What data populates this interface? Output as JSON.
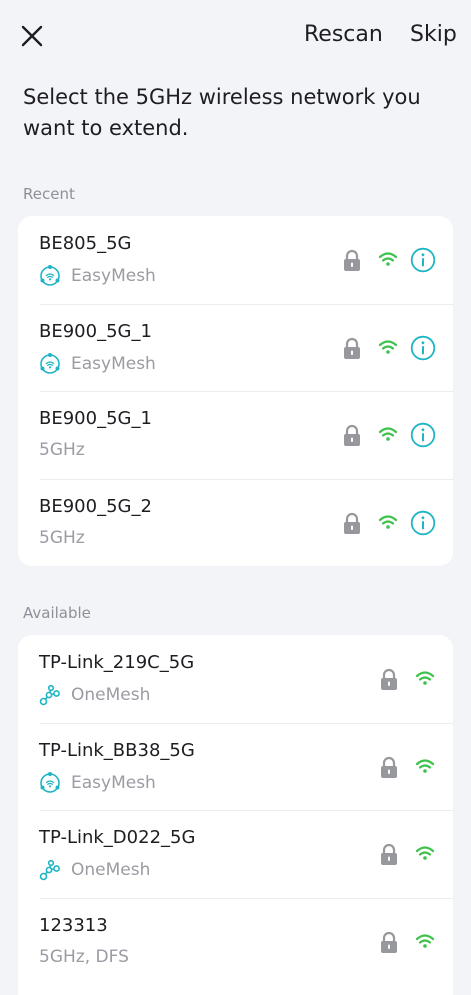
{
  "header": {
    "rescan_label": "Rescan",
    "skip_label": "Skip",
    "title": "Select the 5GHz wireless network you want to extend."
  },
  "recent": {
    "label": "Recent",
    "items": [
      {
        "name": "BE805_5G",
        "sub": "EasyMesh",
        "sub_icon": "easymesh-icon"
      },
      {
        "name": "BE900_5G_1",
        "sub": "EasyMesh",
        "sub_icon": "easymesh-icon"
      },
      {
        "name": "BE900_5G_1",
        "sub": "5GHz",
        "sub_icon": ""
      },
      {
        "name": "BE900_5G_2",
        "sub": "5GHz",
        "sub_icon": ""
      }
    ]
  },
  "available": {
    "label": "Available",
    "items": [
      {
        "name": "TP-Link_219C_5G",
        "sub": "OneMesh",
        "sub_icon": "onemesh-icon"
      },
      {
        "name": "TP-Link_BB38_5G",
        "sub": "EasyMesh",
        "sub_icon": "easymesh-icon"
      },
      {
        "name": "TP-Link_D022_5G",
        "sub": "OneMesh",
        "sub_icon": "onemesh-icon"
      },
      {
        "name": "123313",
        "sub": "5GHz, DFS",
        "sub_icon": ""
      }
    ]
  },
  "colors": {
    "accent": "#1fb5c4",
    "signal": "#3cc24a",
    "lock": "#97989d"
  }
}
